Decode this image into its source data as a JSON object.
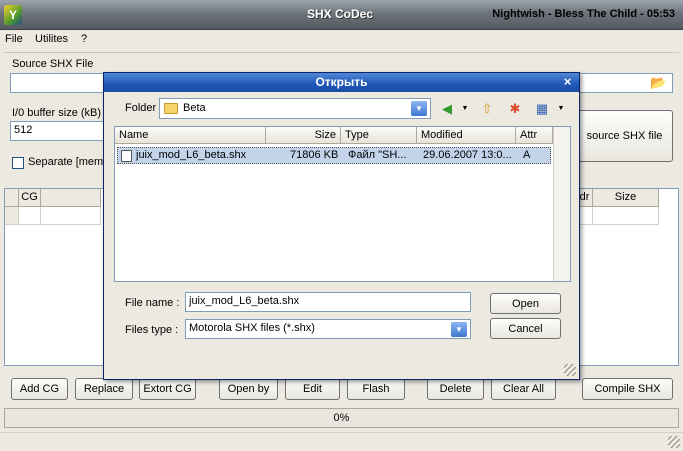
{
  "window": {
    "title": "SHX CoDec",
    "now_playing": "Nightwish - Bless The Child - 05:53"
  },
  "menu": [
    "File",
    "Utilites",
    "?"
  ],
  "source": {
    "label": "Source SHX File",
    "buffer_label": "I/0 buffer size (kB)",
    "buffer_value": "512",
    "separate_label": "Separate [mem",
    "source_button": "source SHX file"
  },
  "grid": {
    "headers": [
      "CG",
      "dr",
      "Size"
    ]
  },
  "buttons": {
    "add_cg": "Add CG",
    "replace": "Replace",
    "extort_cg": "Extort CG",
    "open_by": "Open by",
    "edit": "Edit",
    "flash": "Flash",
    "delete": "Delete",
    "clear_all": "Clear All",
    "compile": "Compile SHX"
  },
  "progress": "0%",
  "dialog": {
    "title": "Открыть",
    "close": "×",
    "folder_label": "Folder",
    "folder_value": "Beta",
    "columns": [
      "Name",
      "Size",
      "Type",
      "Modified",
      "Attr"
    ],
    "files": [
      {
        "name": "juix_mod_L6_beta.shx",
        "size": "71806 KB",
        "type": "Файл \"SH...",
        "modified": "29.06.2007 13:0...",
        "attr": "A"
      }
    ],
    "filename_label": "File name :",
    "filename_value": "juix_mod_L6_beta.shx",
    "filetype_label": "Files type :",
    "filetype_value": "Motorola SHX files (*.shx)",
    "open_button": "Open",
    "cancel_button": "Cancel"
  },
  "colors": {
    "dialog_title": "#2057b8",
    "selection": "#c2d3ea",
    "window_title": "#6e747c"
  }
}
